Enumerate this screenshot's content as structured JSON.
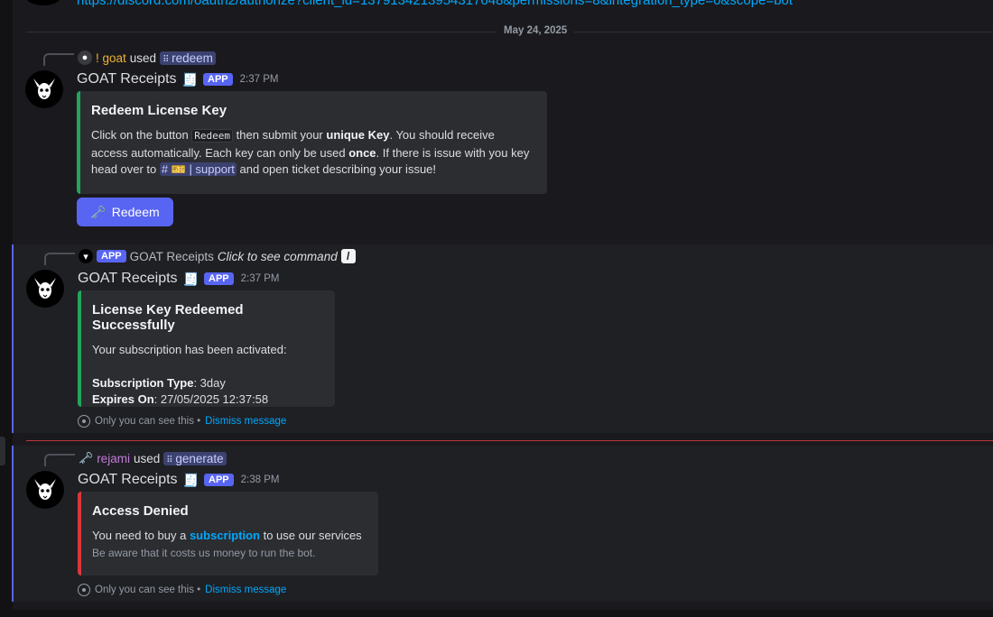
{
  "top_link": "https://discord.com/oauth2/authorize?client_id=1379134213954317648&permissions=8&integration_type=0&scope=bot",
  "date_divider": "May 24, 2025",
  "messages": [
    {
      "reply": {
        "user": "! goat",
        "used": "used",
        "command": "redeem"
      },
      "author": "GOAT Receipts",
      "app_tag": "APP",
      "time": "2:37 PM",
      "embed": {
        "title": "Redeem License Key",
        "desc_1": "Click on the button ",
        "code": "Redeem",
        "desc_2": " then submit your ",
        "bold_1": "unique Key",
        "desc_3": ". You should receive access automatically. Each key can only be used ",
        "bold_2": "once",
        "desc_4": ". If there is issue with you key head over to ",
        "channel": "# 🎫 | support",
        "desc_5": " and open ticket describing your issue!"
      },
      "button_label": "Redeem"
    },
    {
      "reply": {
        "app_tag": "APP",
        "user": "GOAT Receipts",
        "action": "Click to see command"
      },
      "author": "GOAT Receipts",
      "app_tag": "APP",
      "time": "2:37 PM",
      "embed": {
        "title": "License Key Redeemed Successfully",
        "line_1": "Your subscription has been activated:",
        "type_label": "Subscription Type",
        "type_value": ": 3day",
        "expires_label": "Expires On",
        "expires_value": ": 27/05/2025 12:37:58"
      },
      "ephemeral": {
        "text": "Only you can see this •",
        "dismiss": "Dismiss message"
      }
    },
    {
      "reply": {
        "user": "rejami",
        "used": "used",
        "command": "generate"
      },
      "author": "GOAT Receipts",
      "app_tag": "APP",
      "time": "2:38 PM",
      "embed": {
        "title": "Access Denied",
        "line_1a": "You need to buy a ",
        "link": "subscription",
        "line_1b": " to use our services",
        "line_2": "Be aware that it costs us money to run the bot."
      },
      "ephemeral": {
        "text": "Only you can see this •",
        "dismiss": "Dismiss message"
      }
    }
  ],
  "colors": {
    "accent": "#5865f2",
    "success": "#23a55a",
    "danger": "#da373c",
    "link": "#00a8fc"
  }
}
